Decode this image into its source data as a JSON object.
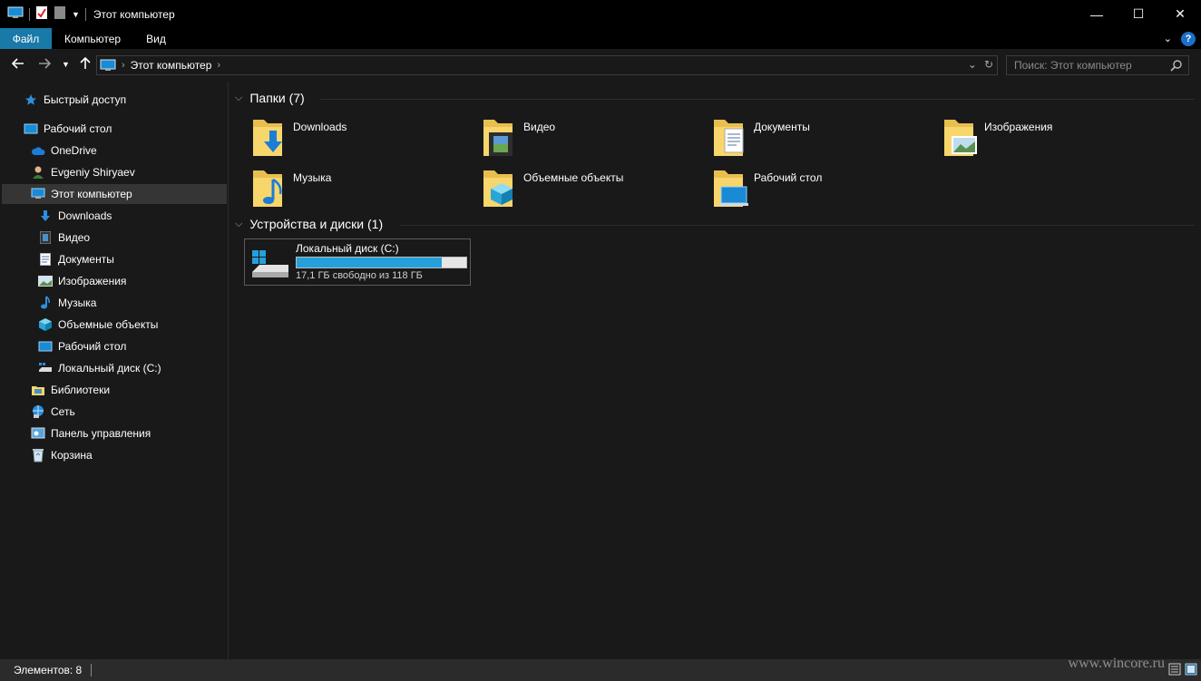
{
  "window": {
    "title": "Этот компьютер",
    "controls": {
      "minimize": "—",
      "maximize": "☐",
      "close": "✕"
    }
  },
  "ribbon": {
    "tabs": [
      "Файл",
      "Компьютер",
      "Вид"
    ],
    "help": "?"
  },
  "address": {
    "crumb": "Этот компьютер",
    "search_placeholder": "Поиск: Этот компьютер"
  },
  "sidebar": {
    "items": [
      {
        "label": "Быстрый доступ",
        "icon": "star-icon"
      },
      {
        "label": "Рабочий стол",
        "icon": "desktop-icon"
      },
      {
        "label": "OneDrive",
        "icon": "cloud-icon"
      },
      {
        "label": "Evgeniy Shiryaev",
        "icon": "user-icon"
      },
      {
        "label": "Этот компьютер",
        "icon": "computer-icon",
        "selected": true
      },
      {
        "label": "Downloads",
        "icon": "download-icon"
      },
      {
        "label": "Видео",
        "icon": "video-icon"
      },
      {
        "label": "Документы",
        "icon": "document-icon"
      },
      {
        "label": "Изображения",
        "icon": "picture-icon"
      },
      {
        "label": "Музыка",
        "icon": "music-icon"
      },
      {
        "label": "Объемные объекты",
        "icon": "cube-icon"
      },
      {
        "label": "Рабочий стол",
        "icon": "desktop-icon"
      },
      {
        "label": "Локальный диск (C:)",
        "icon": "drive-icon"
      },
      {
        "label": "Библиотеки",
        "icon": "library-icon"
      },
      {
        "label": "Сеть",
        "icon": "network-icon"
      },
      {
        "label": "Панель управления",
        "icon": "control-panel-icon"
      },
      {
        "label": "Корзина",
        "icon": "recycle-bin-icon"
      }
    ]
  },
  "content": {
    "folders_header": "Папки (7)",
    "folders": [
      {
        "label": "Downloads",
        "icon": "download-icon"
      },
      {
        "label": "Видео",
        "icon": "video-icon"
      },
      {
        "label": "Документы",
        "icon": "document-icon"
      },
      {
        "label": "Изображения",
        "icon": "picture-icon"
      },
      {
        "label": "Музыка",
        "icon": "music-icon"
      },
      {
        "label": "Объемные объекты",
        "icon": "cube-icon"
      },
      {
        "label": "Рабочий стол",
        "icon": "desktop-icon"
      }
    ],
    "devices_header": "Устройства и диски (1)",
    "drive": {
      "label": "Локальный диск (C:)",
      "free_text": "17,1 ГБ свободно из 118 ГБ",
      "used_fraction": 0.855
    }
  },
  "status": {
    "count": "Элементов: 8"
  },
  "watermark": "www.wincore.ru",
  "colors": {
    "accent": "#1979a8",
    "drive_fill": "#26a0da",
    "folder": "#f7d66b",
    "background": "#191919"
  }
}
